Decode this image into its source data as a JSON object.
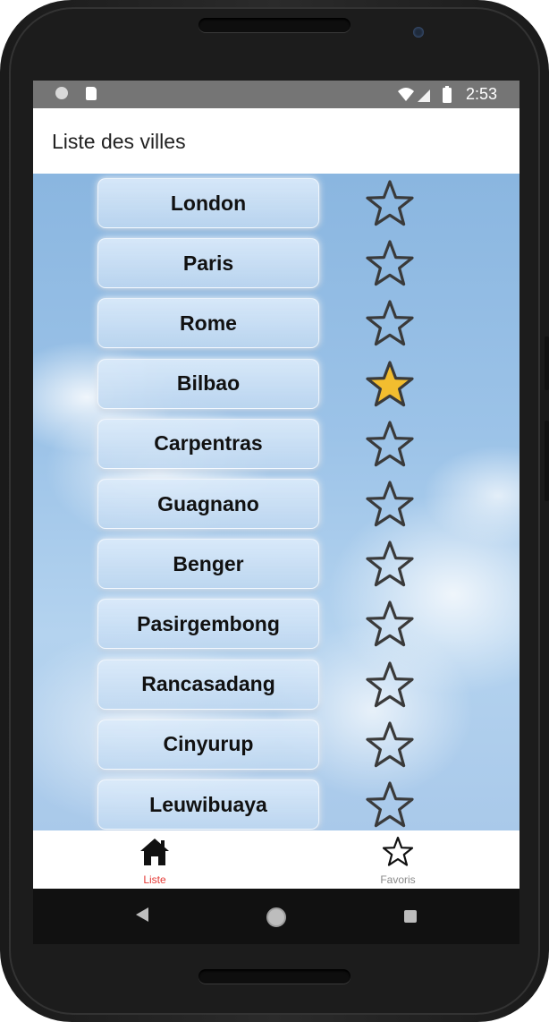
{
  "status_bar": {
    "time": "2:53",
    "left_icons": [
      "circle-notification-icon",
      "sd-card-icon"
    ],
    "right_icons": [
      "wifi-icon",
      "signal-icon",
      "battery-icon"
    ]
  },
  "app_bar": {
    "title": "Liste des villes"
  },
  "cities": [
    {
      "name": "London",
      "favorite": false
    },
    {
      "name": "Paris",
      "favorite": false
    },
    {
      "name": "Rome",
      "favorite": false
    },
    {
      "name": "Bilbao",
      "favorite": true
    },
    {
      "name": "Carpentras",
      "favorite": false
    },
    {
      "name": "Guagnano",
      "favorite": false
    },
    {
      "name": "Benger",
      "favorite": false
    },
    {
      "name": "Pasirgembong",
      "favorite": false
    },
    {
      "name": "Rancasadang",
      "favorite": false
    },
    {
      "name": "Cinyurup",
      "favorite": false
    },
    {
      "name": "Leuwibuaya",
      "favorite": false
    }
  ],
  "bottom_nav": {
    "items": [
      {
        "label": "Liste",
        "icon": "home-icon",
        "active": true
      },
      {
        "label": "Favoris",
        "icon": "star-outline-icon",
        "active": false
      }
    ]
  },
  "colors": {
    "active_tab": "#e53935",
    "inactive_tab": "#8a8a8a",
    "favorite_star_fill": "#f2bd2f",
    "star_outline": "#3a3a3a",
    "status_bar": "#757575"
  },
  "system_nav": {
    "icons": [
      "back-icon",
      "home-circle-icon",
      "recent-apps-icon"
    ]
  }
}
